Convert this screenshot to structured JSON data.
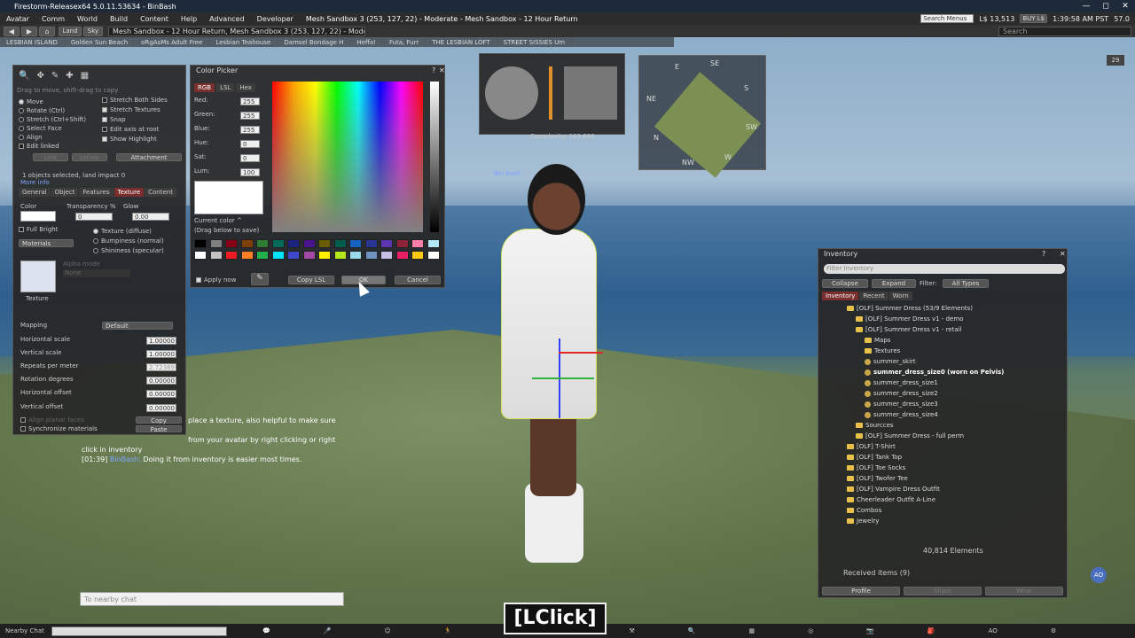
{
  "window": {
    "title": "Firestorm-Releasex64 5.0.11.53634 - BinBash",
    "minimize": "—",
    "maximize": "◻",
    "close": "✕"
  },
  "menu": [
    "Avatar",
    "Comm",
    "World",
    "Build",
    "Content",
    "Help",
    "Advanced",
    "Developer"
  ],
  "location": "Mesh Sandbox 3 (253, 127, 22) - Moderate - Mesh Sandbox - 12 Hour Return",
  "search_menus_placeholder": "Search Menus",
  "balance": "L$ 13,513",
  "buy_label": "BUY L$",
  "time": "1:39:58 AM PST",
  "fps": "57.0",
  "nav": {
    "home": "⌂",
    "land": "Land",
    "sky": "Sky",
    "address": "Mesh Sandbox - 12 Hour Return, Mesh Sandbox 3 (253, 127, 22) - Moderate",
    "search_placeholder": "Search"
  },
  "favorites": [
    "LESBIAN ISLAND",
    "Golden Sun Beach",
    "oRgAsMs Adult Free",
    "Lesbian Teahouse",
    "Damsel Bondage H",
    "Heffa!",
    "Futa, Furr",
    "THE LESBIAN LOFT",
    "STREET SISSIES Um"
  ],
  "build": {
    "hint": "Drag to move, shift-drag to copy",
    "options_left": [
      "Move",
      "Rotate (Ctrl)",
      "Stretch (Ctrl+Shift)",
      "Select Face",
      "Align",
      "Edit linked"
    ],
    "options_right": [
      "Stretch Both Sides",
      "Stretch Textures",
      "Snap",
      "Edit axis at root",
      "Show Highlight"
    ],
    "link": "Link",
    "unlink": "Unlink",
    "attachment": "Attachment",
    "selected_info": "1 objects selected, land impact 0",
    "more_info": "More info",
    "tabs": [
      "General",
      "Object",
      "Features",
      "Texture",
      "Content"
    ],
    "color_label": "Color",
    "transparency_label": "Transparency %",
    "transparency_value": "0",
    "glow_label": "Glow",
    "glow_value": "0.00",
    "full_bright": "Full Bright",
    "materials": "Materials",
    "texture_opts": [
      "Texture (diffuse)",
      "Bumpiness (normal)",
      "Shininess (specular)"
    ],
    "alpha_mode": "Alpha mode",
    "alpha_value": "None",
    "texture_label": "Texture",
    "mapping_label": "Mapping",
    "mapping_value": "Default",
    "params": [
      {
        "label": "Horizontal scale",
        "value": "1.00000"
      },
      {
        "label": "Vertical scale",
        "value": "1.00000"
      },
      {
        "label": "Repeats per meter",
        "value": "2.72389"
      },
      {
        "label": "Rotation degrees",
        "value": "0.00000"
      },
      {
        "label": "Horizontal offset",
        "value": "0.00000"
      },
      {
        "label": "Vertical offset",
        "value": "0.00000"
      }
    ],
    "align_planar": "Align planar faces",
    "sync_materials": "Synchronize materials",
    "copy": "Copy",
    "paste": "Paste"
  },
  "color_picker": {
    "title": "Color Picker",
    "tabs": [
      "RGB",
      "LSL",
      "Hex"
    ],
    "fields": [
      {
        "label": "Red:",
        "value": "255"
      },
      {
        "label": "Green:",
        "value": "255"
      },
      {
        "label": "Blue:",
        "value": "255"
      },
      {
        "label": "Hue:",
        "value": "0"
      },
      {
        "label": "Sat:",
        "value": "0"
      },
      {
        "label": "Lum:",
        "value": "100"
      }
    ],
    "current_color": "Current color ^",
    "drag_hint": "(Drag below to save)",
    "apply_now": "Apply now",
    "copy_lsl": "Copy LSL",
    "ok": "OK",
    "cancel": "Cancel",
    "swatches_row1": [
      "#000000",
      "#7f7f7f",
      "#880015",
      "#7f3f00",
      "#2e7d32",
      "#00695c",
      "#1a237e",
      "#4a148c",
      "#6a5c00",
      "#005e4f",
      "#1565c0",
      "#283593",
      "#5e35b1",
      "#8e2439",
      "#ff80ab",
      "#b3e5fc"
    ],
    "swatches_row2": [
      "#ffffff",
      "#c3c3c3",
      "#ed1c24",
      "#ff7f27",
      "#22b14c",
      "#00e5ff",
      "#3f48cc",
      "#a349a4",
      "#fff200",
      "#b5e61d",
      "#99d9ea",
      "#7092be",
      "#c8bfe7",
      "#e91e63",
      "#ffc90e",
      "#ffffff"
    ]
  },
  "chat": {
    "line1": "place a texture, also helpful to make sure",
    "line2": "from your avatar by right clicking or right",
    "line3": "click in inventory",
    "line4_time": "[01:39]",
    "line4_name": "BinBash:",
    "line4_text": "Doing it from inventory is easier most times.",
    "input_placeholder": "To nearby chat"
  },
  "scene": {
    "name_tag": "Bin Bash",
    "complexity": "Complexity: 103,690"
  },
  "minimap": {
    "n": "N",
    "ne": "NE",
    "e": "E",
    "se": "SE",
    "s": "S",
    "sw": "SW",
    "w": "W",
    "nw": "NW"
  },
  "right_badge": "29",
  "inventory": {
    "title": "Inventory",
    "filter_placeholder": "Filter Inventory",
    "collapse": "Collapse",
    "expand": "Expand",
    "filter_label": "Filter:",
    "filter_value": "All Types",
    "tabs": [
      "Inventory",
      "Recent",
      "Worn"
    ],
    "rows": [
      {
        "indent": 0,
        "type": "folder",
        "text": "[OLF] Summer Dress (53/9 Elements)"
      },
      {
        "indent": 1,
        "type": "folder",
        "text": "[OLF] Summer Dress v1 - demo"
      },
      {
        "indent": 1,
        "type": "folder",
        "text": "[OLF] Summer Dress v1 - retail"
      },
      {
        "indent": 2,
        "type": "folder",
        "text": "Maps"
      },
      {
        "indent": 2,
        "type": "folder",
        "text": "Textures"
      },
      {
        "indent": 2,
        "type": "item",
        "text": "summer_skirt"
      },
      {
        "indent": 2,
        "type": "item",
        "text": "summer_dress_size0 (worn on Pelvis)",
        "bold": true
      },
      {
        "indent": 2,
        "type": "item",
        "text": "summer_dress_size1"
      },
      {
        "indent": 2,
        "type": "item",
        "text": "summer_dress_size2"
      },
      {
        "indent": 2,
        "type": "item",
        "text": "summer_dress_size3"
      },
      {
        "indent": 2,
        "type": "item",
        "text": "summer_dress_size4"
      },
      {
        "indent": 1,
        "type": "folder",
        "text": "Sourcces"
      },
      {
        "indent": 1,
        "type": "folder",
        "text": "[OLF] Summer Dress - full perm"
      },
      {
        "indent": 0,
        "type": "folder",
        "text": "[OLF] T-Shirt"
      },
      {
        "indent": 0,
        "type": "folder",
        "text": "[OLF] Tank Top"
      },
      {
        "indent": 0,
        "type": "folder",
        "text": "[OLF] Toe Socks"
      },
      {
        "indent": 0,
        "type": "folder",
        "text": "[OLF] Twofer Tee"
      },
      {
        "indent": 0,
        "type": "folder",
        "text": "[OLF] Vampire Dress Outfit"
      },
      {
        "indent": 0,
        "type": "folder",
        "text": "Cheerleader Outfit A-Line"
      },
      {
        "indent": 0,
        "type": "folder",
        "text": "Combos"
      },
      {
        "indent": 0,
        "type": "folder",
        "text": "Jewelry"
      }
    ],
    "element_count": "40,814 Elements",
    "received": "Received items (9)",
    "profile": "Profile",
    "share": "Share",
    "wear": "Wear"
  },
  "bottom": {
    "nearby_chat": "Nearby Chat",
    "ao": "AO"
  },
  "overlay_label": "[LClick]"
}
